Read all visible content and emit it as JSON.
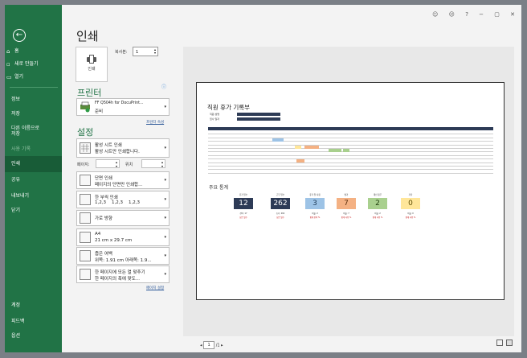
{
  "nav": {
    "back": "←",
    "items_top": [
      {
        "icon": "⌂",
        "label": "홈"
      },
      {
        "icon": "▫",
        "label": "새로 만들기"
      },
      {
        "icon": "▭",
        "label": "열기"
      }
    ],
    "items_mid": [
      "정보",
      "저장",
      "다른 이름으로\n저장",
      "사용 기록",
      "인쇄",
      "공유",
      "내보내기",
      "닫기"
    ],
    "items_bottom": [
      "계정",
      "피드백",
      "옵션"
    ],
    "selected": "인쇄"
  },
  "window_controls": [
    "☺",
    "☹",
    "?",
    "−",
    "▢",
    "✕"
  ],
  "page_title": "인쇄",
  "print_button": "인쇄",
  "copies": {
    "label": "복사본:",
    "value": "1"
  },
  "printer_section": {
    "heading": "프린터",
    "name": "FF Q504h for DocuPrint...",
    "status": "준비",
    "link": "프린터 속성"
  },
  "settings_section": {
    "heading": "설정",
    "sheet": {
      "line1": "활성 시트 인쇄",
      "line2": "활성 시트만 인쇄합니다."
    },
    "pages_label": "페이지:",
    "to_label": "위치",
    "sides": {
      "line1": "단면 인쇄",
      "line2": "페이지의 단면만 인쇄합..."
    },
    "collate": {
      "line1": "한 부씩 인쇄",
      "line2": "1,2,3    1,2,3    1,2,3"
    },
    "orientation": {
      "line1": "가로 방향"
    },
    "paper": {
      "line1": "A4",
      "line2": "21 cm x 29.7 cm"
    },
    "margins": {
      "line1": "좁은 여백",
      "line2": "위쪽: 1.91 cm 아래쪽: 1.9..."
    },
    "scaling": {
      "line1": "한 페이지에 모든 열 맞추기",
      "line2": "한 페이지의 폭에 맞도..."
    },
    "page_setup_link": "페이지 설정"
  },
  "preview": {
    "doc_title": "직원 휴가 기록부",
    "meta": [
      {
        "label": "직원 성명",
        "value": "000"
      },
      {
        "label": "입사 일자",
        "value": "2018"
      }
    ],
    "stats_heading": "주요 통계",
    "cards": [
      {
        "label": "휴가 일수",
        "value": "12",
        "color": "#2d3b56",
        "text": "#ffffff",
        "sub": "잔여: 17",
        "note": "남은 일수"
      },
      {
        "label": "근무 일수",
        "value": "262",
        "color": "#2d3b56",
        "text": "#ffffff",
        "sub": "휴가: 262",
        "note": "남은 일수"
      },
      {
        "label": "휴가 일 사용",
        "value": "3",
        "color": "#9dc3e6",
        "text": "#1f3b57",
        "sub": "비율: 2",
        "note": "합계 잔여 %"
      },
      {
        "label": "병가",
        "value": "7",
        "color": "#f4b183",
        "text": "#5a2d0c",
        "sub": "비율: 7",
        "note": "합계 사용 %"
      },
      {
        "label": "개인 용무",
        "value": "2",
        "color": "#a9d08e",
        "text": "#20400e",
        "sub": "비율: 2",
        "note": "합계 사용 %"
      },
      {
        "label": "기타",
        "value": "0",
        "color": "#ffe699",
        "text": "#5a4a00",
        "sub": "비율: 0",
        "note": "합계 사용 %"
      }
    ]
  },
  "pager": {
    "prev": "◂",
    "current": "1",
    "total": "/1",
    "next": "▸"
  }
}
